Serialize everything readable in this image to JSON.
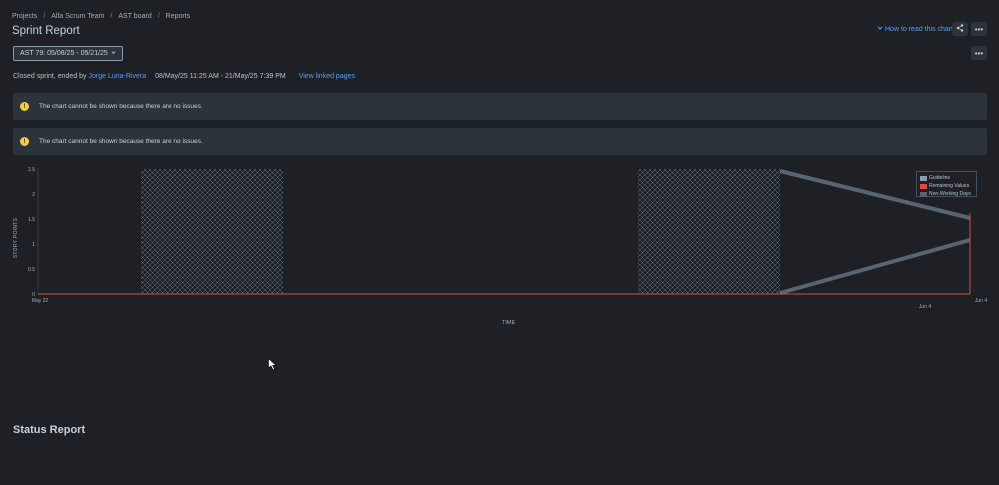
{
  "breadcrumb": {
    "items": [
      "Projects",
      "Alfa Scrum Team",
      "AST board",
      "Reports"
    ],
    "separator": "/"
  },
  "page_title": "Sprint Report",
  "how_to_read": "How to read this chart",
  "sprint_select": {
    "value": "AST 79: 05/08/25 - 05/21/25"
  },
  "meta": {
    "prefix": "Closed sprint, ended by",
    "user": "Jorge Luna-Rivera",
    "dates": "08/May/25 11:25 AM - 21/May/25 7:39 PM",
    "view_linked": "View linked pages"
  },
  "banners": [
    {
      "message": "The chart cannot be shown because there are no issues."
    },
    {
      "message": "The chart cannot be shown because there are no issues."
    }
  ],
  "chart_data": {
    "type": "line",
    "ylabel": "STORY POINTS",
    "xlabel": "TIME",
    "y_ticks": [
      "0",
      "0.5",
      "1",
      "1.5",
      "2",
      "2.5"
    ],
    "ylim": [
      0,
      2.5
    ],
    "x_ticks": [
      "May 22",
      "Jun 4",
      "Jun 4"
    ],
    "legend_position": "top-right",
    "series": [
      {
        "name": "Guideline",
        "color": "#8c9bab"
      },
      {
        "name": "Remaining Values",
        "color": "#e2483d"
      },
      {
        "name": "Non-Working Days",
        "color": "#5a6470"
      }
    ]
  },
  "status_report_title": "Status Report",
  "colors": {
    "accent": "#579dff",
    "warning": "#f5cd47",
    "remaining": "#e2483d"
  }
}
